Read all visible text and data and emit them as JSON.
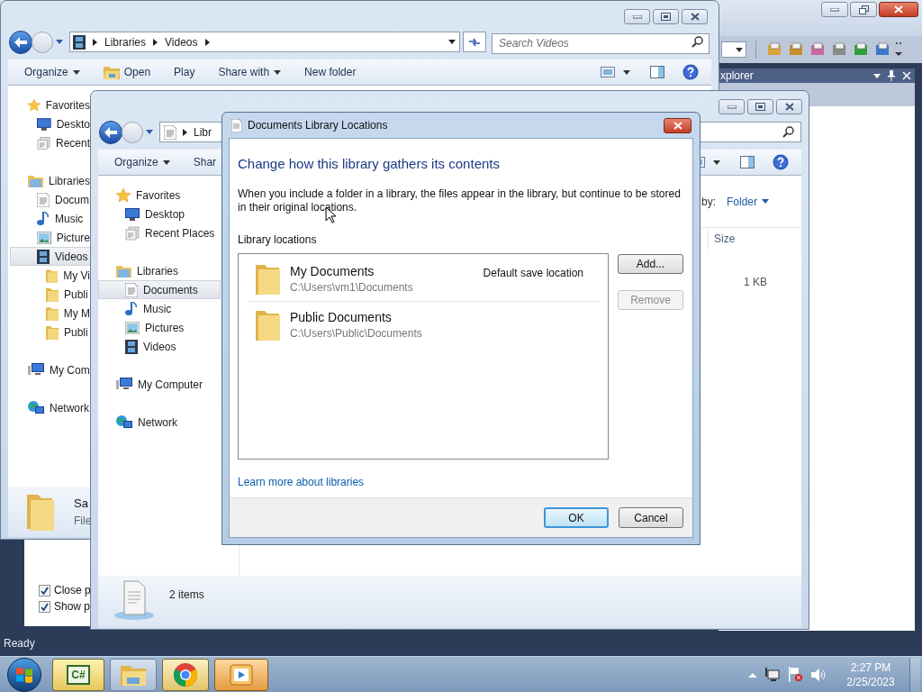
{
  "ide": {
    "panel_title": "xplorer",
    "status": "Ready"
  },
  "background_dialog": {
    "checkboxes": [
      {
        "label": "Close p",
        "checked": true
      },
      {
        "label": "Show p",
        "checked": true
      }
    ]
  },
  "explorer_back": {
    "breadcrumb": [
      "Libraries",
      "Videos"
    ],
    "search_placeholder": "Search Videos",
    "toolbar": [
      {
        "label": "Organize",
        "kind": "menu"
      },
      {
        "label": "Open",
        "kind": "open"
      },
      {
        "label": "Play",
        "kind": "plain"
      },
      {
        "label": "Share with",
        "kind": "menu"
      },
      {
        "label": "New folder",
        "kind": "plain"
      }
    ],
    "nav": [
      {
        "label": "Favorites",
        "kind": "favorites",
        "selected": false,
        "children": [
          {
            "label": "Deskto",
            "kind": "desktop",
            "selected": false
          },
          {
            "label": "Recent",
            "kind": "recent",
            "selected": false
          }
        ]
      },
      {
        "label": "Libraries",
        "kind": "library",
        "selected": false,
        "children": [
          {
            "label": "Docum",
            "kind": "documents",
            "selected": false
          },
          {
            "label": "Music",
            "kind": "music",
            "selected": false
          },
          {
            "label": "Picture",
            "kind": "pictures",
            "selected": false
          },
          {
            "label": "Videos",
            "kind": "videos",
            "selected": true,
            "children": [
              {
                "label": "My Vi",
                "kind": "folder",
                "selected": false
              },
              {
                "label": "Publi",
                "kind": "folder",
                "selected": false
              },
              {
                "label": "My M",
                "kind": "folder",
                "selected": false
              },
              {
                "label": "Publi",
                "kind": "folder",
                "selected": false
              }
            ]
          }
        ]
      },
      {
        "label": "My Com",
        "kind": "computer",
        "selected": false
      },
      {
        "label": "Network",
        "kind": "network",
        "selected": false
      }
    ],
    "details": {
      "name": "Sa",
      "type": "File"
    }
  },
  "explorer_front": {
    "breadcrumb": [
      "Libr"
    ],
    "toolbar": [
      {
        "label": "Organize",
        "kind": "menu"
      },
      {
        "label": "Shar",
        "kind": "plain"
      }
    ],
    "nav": [
      {
        "label": "Favorites",
        "kind": "favorites",
        "selected": false,
        "children": [
          {
            "label": "Desktop",
            "kind": "desktop",
            "selected": false
          },
          {
            "label": "Recent Places",
            "kind": "recent",
            "selected": false
          }
        ]
      },
      {
        "label": "Libraries",
        "kind": "library",
        "selected": false,
        "children": [
          {
            "label": "Documents",
            "kind": "documents",
            "selected": true
          },
          {
            "label": "Music",
            "kind": "music",
            "selected": false
          },
          {
            "label": "Pictures",
            "kind": "pictures",
            "selected": false
          },
          {
            "label": "Videos",
            "kind": "videos",
            "selected": false
          }
        ]
      },
      {
        "label": "My Computer",
        "kind": "computer",
        "selected": false
      },
      {
        "label": "Network",
        "kind": "network",
        "selected": false
      }
    ],
    "arrange_label": "by:",
    "arrange_value": "Folder",
    "columns": [
      "Size"
    ],
    "rows": [
      [
        "1 KB"
      ]
    ],
    "details": {
      "count": "2 items"
    }
  },
  "dialog": {
    "title": "Documents Library Locations",
    "heading": "Change how this library gathers its contents",
    "description": "When you include a folder in a library, the files appear in the library, but continue to be stored in their original locations.",
    "list_label": "Library locations",
    "locations": [
      {
        "name": "My Documents",
        "path": "C:\\Users\\vm1\\Documents",
        "note": "Default save location"
      },
      {
        "name": "Public Documents",
        "path": "C:\\Users\\Public\\Documents"
      }
    ],
    "side_buttons": [
      {
        "label": "Add...",
        "disabled": false
      },
      {
        "label": "Remove",
        "disabled": true
      }
    ],
    "link": "Learn more about libraries",
    "buttons": [
      {
        "label": "OK",
        "default": true
      },
      {
        "label": "Cancel",
        "default": false
      }
    ]
  },
  "taskbar": {
    "apps": [
      {
        "kind": "csharp",
        "glyph": "C#"
      },
      {
        "kind": "explorer"
      },
      {
        "kind": "chrome"
      },
      {
        "kind": "media"
      }
    ],
    "time": "2:27 PM",
    "date": "2/25/2023"
  }
}
